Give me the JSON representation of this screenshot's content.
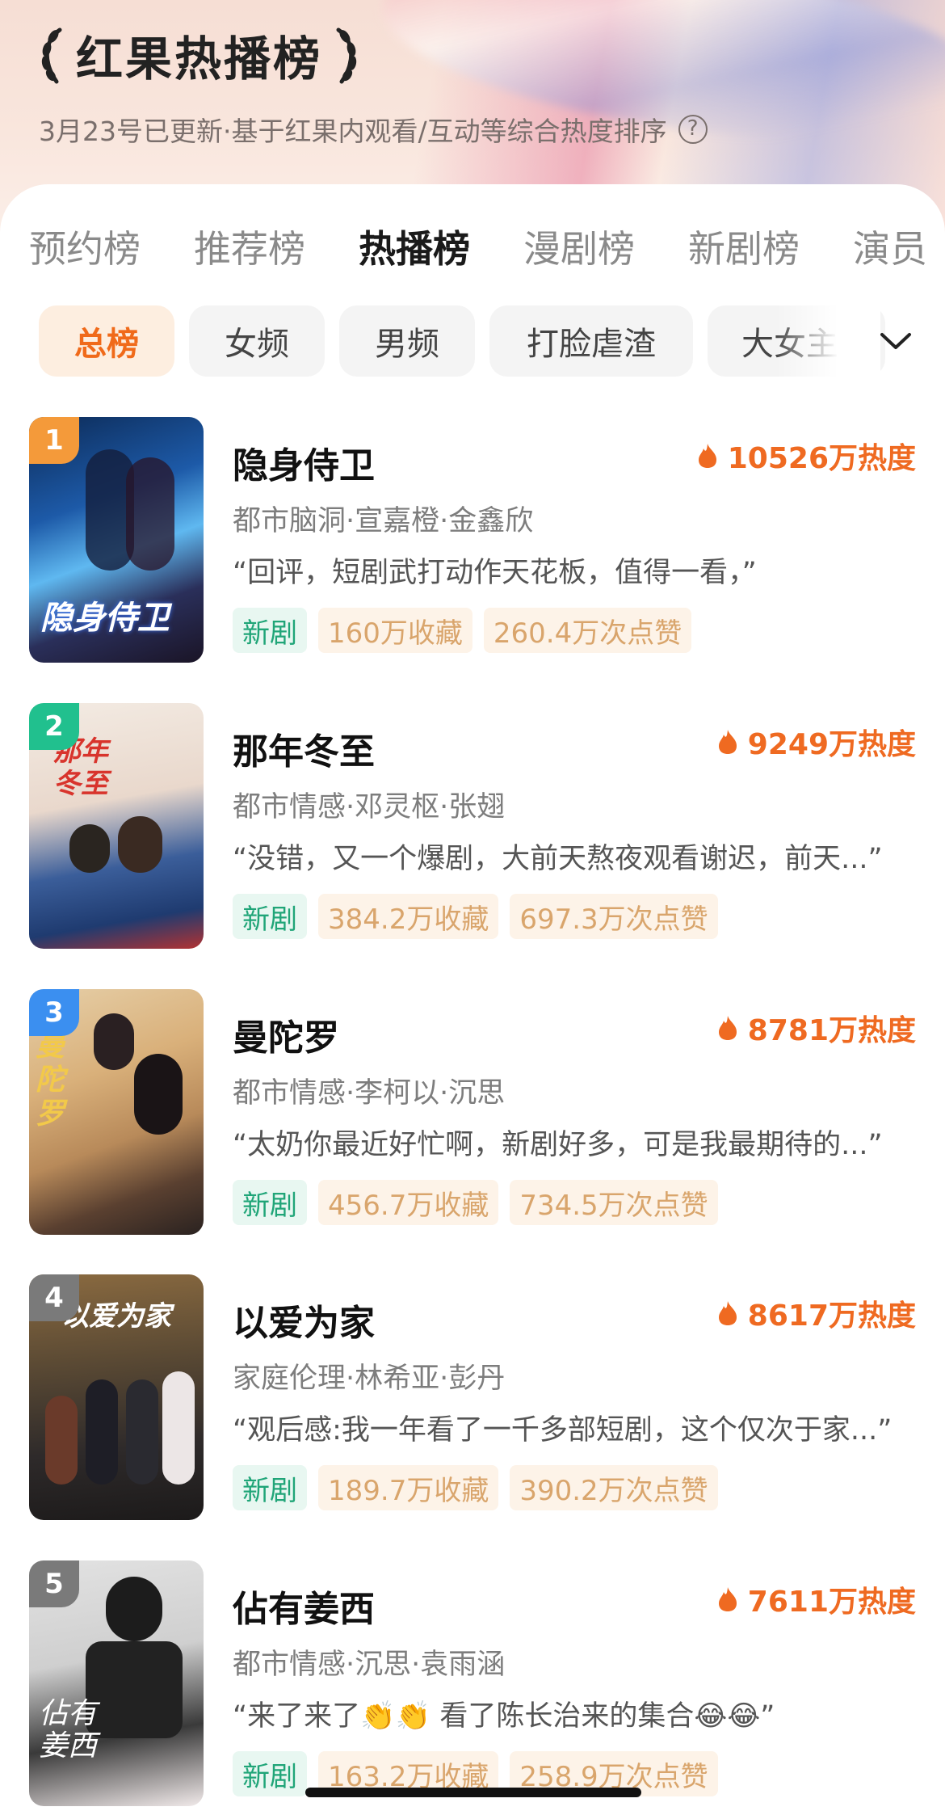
{
  "header": {
    "title": "红果热播榜",
    "subtitle": "3月23号已更新·基于红果内观看/互动等综合热度排序"
  },
  "tabs": [
    "预约榜",
    "推荐榜",
    "热播榜",
    "漫剧榜",
    "新剧榜",
    "演员"
  ],
  "active_tab": "热播榜",
  "chips": [
    "总榜",
    "女频",
    "男频",
    "打脸虐渣",
    "大女主"
  ],
  "active_chip": "总榜",
  "colors": {
    "accent": "#ef6a21",
    "new_tag_text": "#20a578",
    "stat_tag_text": "#d9a56c",
    "rank1": "#f49a3a",
    "rank2": "#21c08e",
    "rank3": "#3b8ff0",
    "rank4": "#7a7a7a",
    "rank5": "#7a7a7a"
  },
  "items": [
    {
      "rank": "1",
      "name": "隐身侍卫",
      "heat": "10526万热度",
      "meta": "都市脑洞·宣嘉橙·金鑫欣",
      "quote": "“回评，短剧武打动作天花板，值得一看，”",
      "tag_new": "新剧",
      "favorites": "160万收藏",
      "likes": "260.4万次点赞",
      "poster_caption": "隐身侍卫"
    },
    {
      "rank": "2",
      "name": "那年冬至",
      "heat": "9249万热度",
      "meta": "都市情感·邓灵枢·张翅",
      "quote": "“没错，又一个爆剧，大前天熬夜观看谢迟，前天...”",
      "tag_new": "新剧",
      "favorites": "384.2万收藏",
      "likes": "697.3万次点赞",
      "poster_caption": "那年冬至"
    },
    {
      "rank": "3",
      "name": "曼陀罗",
      "heat": "8781万热度",
      "meta": "都市情感·李柯以·沉思",
      "quote": "“太奶你最近好忙啊，新剧好多，可是我最期待的...”",
      "tag_new": "新剧",
      "favorites": "456.7万收藏",
      "likes": "734.5万次点赞",
      "poster_caption": "曼陀罗"
    },
    {
      "rank": "4",
      "name": "以爱为家",
      "heat": "8617万热度",
      "meta": "家庭伦理·林希亚·彭丹",
      "quote": "“观后感:我一年看了一千多部短剧，这个仅次于家...”",
      "tag_new": "新剧",
      "favorites": "189.7万收藏",
      "likes": "390.2万次点赞",
      "poster_caption": "以爱为家"
    },
    {
      "rank": "5",
      "name": "佔有姜西",
      "heat": "7611万热度",
      "meta": "都市情感·沉思·袁雨涵",
      "quote": "“来了来了👏👏 看了陈长治来的集合😂😂”",
      "tag_new": "新剧",
      "favorites": "163.2万收藏",
      "likes": "258.9万次点赞",
      "poster_caption": "佔有姜西"
    }
  ]
}
